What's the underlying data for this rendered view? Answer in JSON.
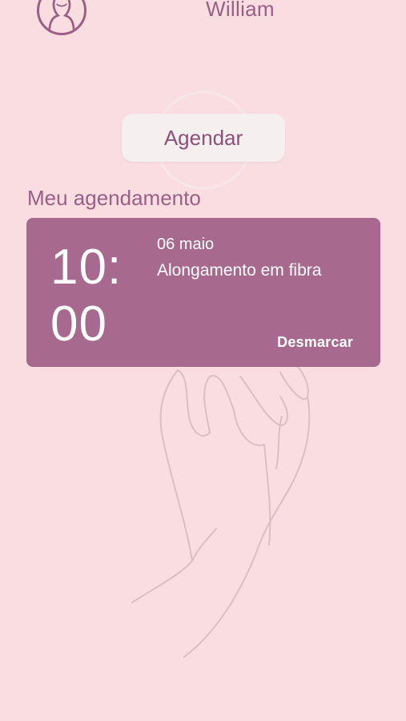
{
  "header": {
    "avatar_icon": "avatar-icon",
    "user_name": "William"
  },
  "schedule_button": {
    "label": "Agendar"
  },
  "section": {
    "title": "Meu agendamento"
  },
  "appointment": {
    "time_hour": "10:",
    "time_minute": "00",
    "date": "06 maio",
    "service": "Alongamento em fibra",
    "cancel_label": "Desmarcar"
  },
  "colors": {
    "background": "#fadde1",
    "accent": "#9b5f86",
    "card": "#9a5882",
    "button_bg": "#f6eff0"
  }
}
